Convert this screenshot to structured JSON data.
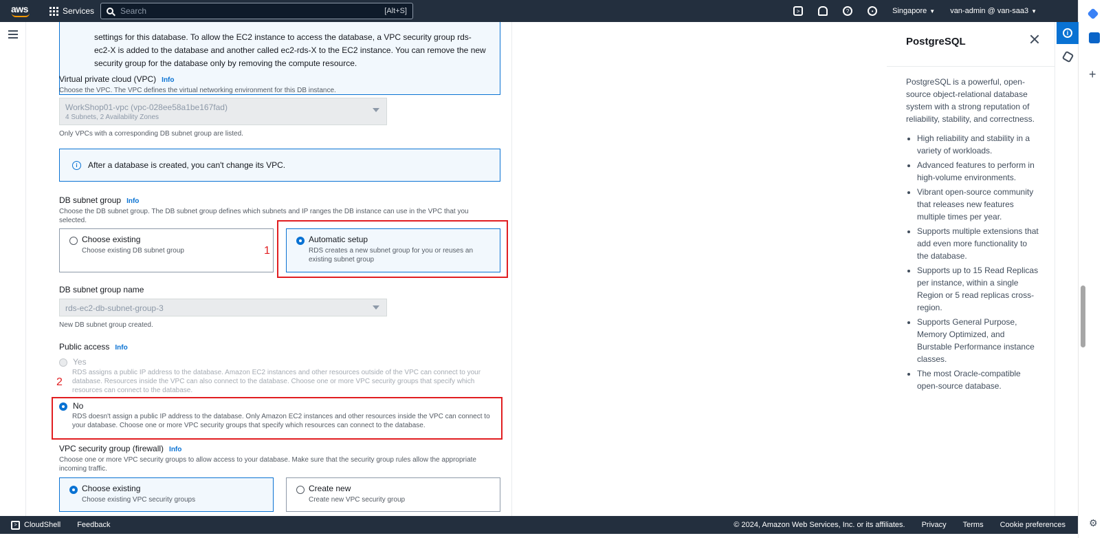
{
  "topbar": {
    "logo": "aws",
    "services_label": "Services",
    "search_placeholder": "Search",
    "search_shortcut": "[Alt+S]",
    "region": "Singapore",
    "account": "van-admin @ van-saa3",
    "icons": [
      "cloudshell-icon",
      "bell-icon",
      "help-icon",
      "settings-icon"
    ]
  },
  "form": {
    "compute_note": "settings for this database. To allow the EC2 instance to access the database, a VPC security group rds-ec2-X is added to the database and another called ec2-rds-X to the EC2 instance. You can remove the new security group for the database only by removing the compute resource.",
    "vpc": {
      "label": "Virtual private cloud (VPC)",
      "info": "Info",
      "desc": "Choose the VPC. The VPC defines the virtual networking environment for this DB instance.",
      "value": "WorkShop01-vpc (vpc-028ee58a1be167fad)",
      "value_sub": "4 Subnets, 2 Availability Zones",
      "hint": "Only VPCs with a corresponding DB subnet group are listed.",
      "alert": "After a database is created, you can't change its VPC."
    },
    "subnet_group": {
      "label": "DB subnet group",
      "info": "Info",
      "desc": "Choose the DB subnet group. The DB subnet group defines which subnets and IP ranges the DB instance can use in the VPC that you selected.",
      "choose_existing_title": "Choose existing",
      "choose_existing_desc": "Choose existing DB subnet group",
      "automatic_title": "Automatic setup",
      "automatic_desc": "RDS creates a new subnet group for you or reuses an existing subnet group",
      "name_label": "DB subnet group name",
      "name_value": "rds-ec2-db-subnet-group-3",
      "name_hint": "New DB subnet group created."
    },
    "public_access": {
      "label": "Public access",
      "info": "Info",
      "yes_title": "Yes",
      "yes_desc": "RDS assigns a public IP address to the database. Amazon EC2 instances and other resources outside of the VPC can connect to your database. Resources inside the VPC can also connect to the database. Choose one or more VPC security groups that specify which resources can connect to the database.",
      "no_title": "No",
      "no_desc": "RDS doesn't assign a public IP address to the database. Only Amazon EC2 instances and other resources inside the VPC can connect to your database. Choose one or more VPC security groups that specify which resources can connect to the database."
    },
    "security_group": {
      "label": "VPC security group (firewall)",
      "info": "Info",
      "desc": "Choose one or more VPC security groups to allow access to your database. Make sure that the security group rules allow the appropriate incoming traffic.",
      "choose_existing_title": "Choose existing",
      "choose_existing_desc": "Choose existing VPC security groups",
      "create_new_title": "Create new",
      "create_new_desc": "Create new VPC security group"
    },
    "annotations": {
      "one": "1",
      "two": "2"
    }
  },
  "help_panel": {
    "title": "PostgreSQL",
    "intro": "PostgreSQL is a powerful, open-source object-relational database system with a strong reputation of reliability, stability, and correctness.",
    "bullets": [
      "High reliability and stability in a variety of workloads.",
      "Advanced features to perform in high-volume environments.",
      "Vibrant open-source community that releases new features multiple times per year.",
      "Supports multiple extensions that add even more functionality to the database.",
      "Supports up to 15 Read Replicas per instance, within a single Region or 5 read replicas cross-region.",
      "Supports General Purpose, Memory Optimized, and Burstable Performance instance classes.",
      "The most Oracle-compatible open-source database."
    ]
  },
  "footer": {
    "cloudshell": "CloudShell",
    "feedback": "Feedback",
    "copyright": "© 2024, Amazon Web Services, Inc. or its affiliates.",
    "privacy": "Privacy",
    "terms": "Terms",
    "cookies": "Cookie preferences"
  },
  "colors": {
    "accent": "#0972d3",
    "topbar": "#232f3e",
    "annotation": "#e11d20"
  }
}
